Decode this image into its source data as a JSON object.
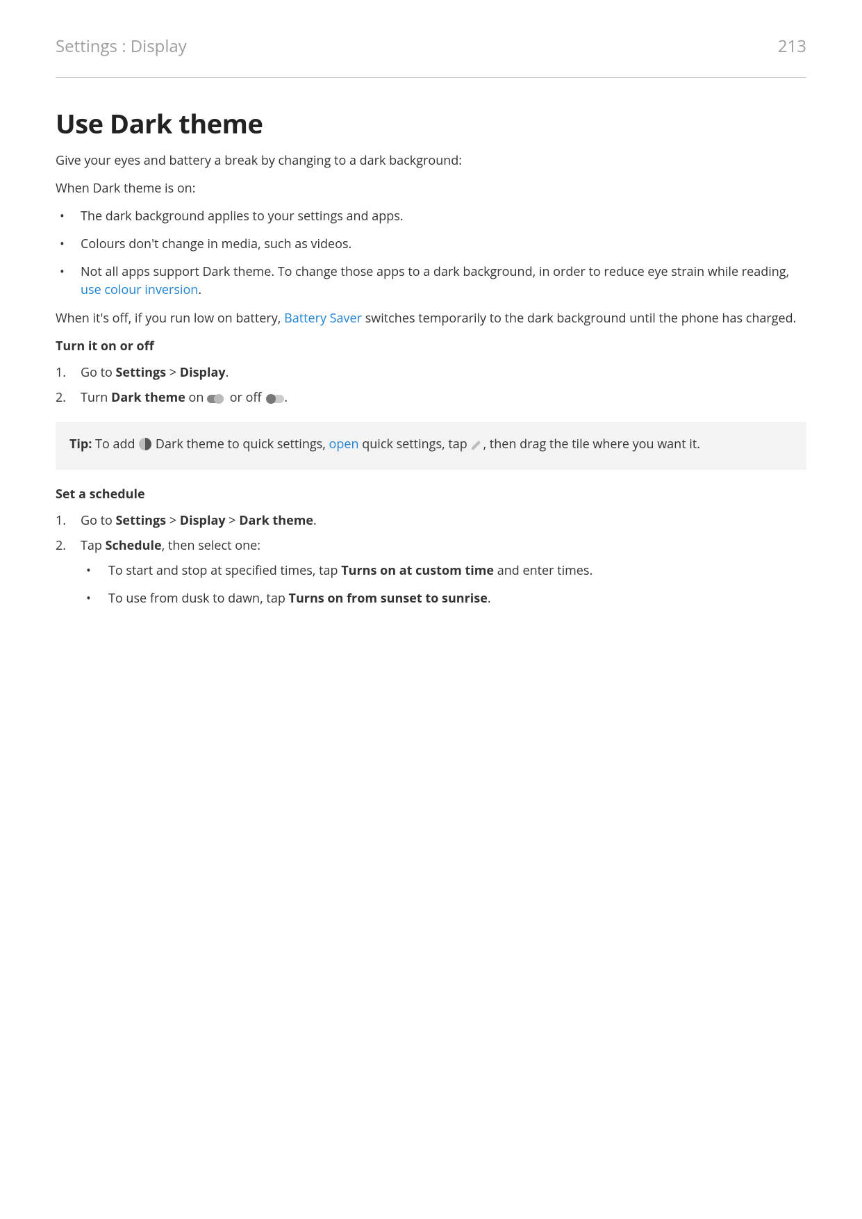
{
  "header": {
    "breadcrumb": "Settings : Display",
    "page_number": "213"
  },
  "title": "Use Dark theme",
  "intro": "Give your eyes and battery a break by changing to a dark background:",
  "when_on_label": "When Dark theme is on:",
  "when_on_bullets": [
    "The dark background applies to your settings and apps.",
    "Colours don't change in media, such as videos."
  ],
  "when_on_bullet3_pre": "Not all apps support Dark theme. To change those apps to a dark background, in order to reduce eye strain while reading, ",
  "link_colour_inversion": "use colour inversion",
  "when_on_bullet3_post": ".",
  "off_p_pre": "When it's off, if you run low on battery, ",
  "link_battery_saver": "Battery Saver",
  "off_p_post": " switches temporarily to the dark background until the phone has charged.",
  "turn_heading": "Turn it on or off",
  "turn_step1_pre": "Go to ",
  "turn_step1_bold1": "Settings",
  "turn_step1_sep": " > ",
  "turn_step1_bold2": "Display",
  "turn_step1_post": ".",
  "turn_step2_pre": "Turn ",
  "turn_step2_bold": "Dark theme",
  "turn_step2_mid1": " on ",
  "turn_step2_mid2": " or off ",
  "turn_step2_post": ".",
  "tip": {
    "label_bold": "Tip:",
    "pre": " To add ",
    "mid1": " Dark theme to quick settings, ",
    "link_open": "open",
    "mid2": " quick settings, tap ",
    "post": ", then drag the tile where you want it."
  },
  "schedule_heading": "Set a schedule",
  "sched_step1_pre": "Go to ",
  "sched_step1_b1": "Settings",
  "sched_step1_sep": " > ",
  "sched_step1_b2": "Display",
  "sched_step1_b3": "Dark theme",
  "sched_step1_post": ".",
  "sched_step2_pre": "Tap ",
  "sched_step2_bold": "Schedule",
  "sched_step2_post": ", then select one:",
  "sched_sub1_pre": "To start and stop at specified times, tap ",
  "sched_sub1_bold": "Turns on at custom time",
  "sched_sub1_post": " and enter times.",
  "sched_sub2_pre": "To use from dusk to dawn, tap ",
  "sched_sub2_bold": "Turns on from sunset to sunrise",
  "sched_sub2_post": "."
}
